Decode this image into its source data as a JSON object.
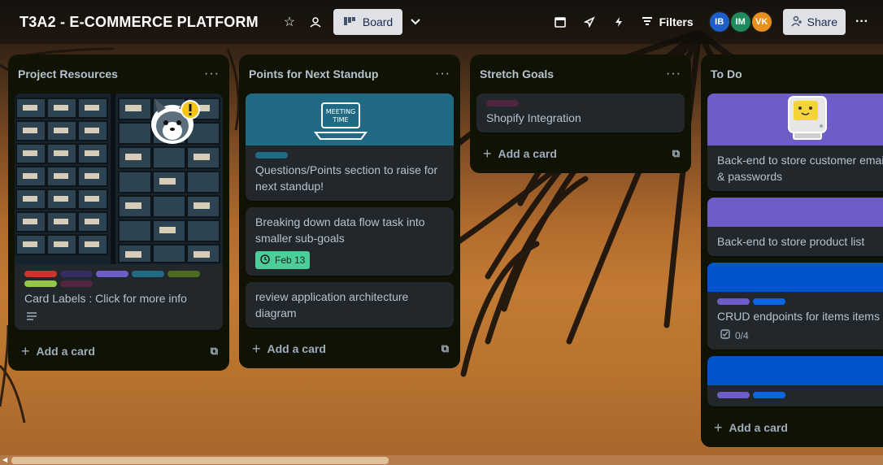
{
  "board": {
    "title": "T3A2 - E-COMMERCE PLATFORM",
    "view_label": "Board",
    "filters_label": "Filters",
    "share_label": "Share",
    "members": [
      {
        "initials": "IB",
        "color": "#1d5ec9"
      },
      {
        "initials": "IM",
        "color": "#1f8a5b"
      },
      {
        "initials": "VK",
        "color": "#e8901e"
      }
    ]
  },
  "lists": [
    {
      "title": "Project Resources",
      "add_card": "Add a card",
      "cards": [
        {
          "title": "Card Labels : Click for more info",
          "labels": [
            "#c9372c",
            "#352c63",
            "#6e5dc6",
            "#206a83",
            "#4c6b1f",
            "#94c748",
            "#50253f"
          ],
          "cover": "photo",
          "icons": [
            "description-icon"
          ]
        }
      ]
    },
    {
      "title": "Points for Next Standup",
      "add_card": "Add a card",
      "cards": [
        {
          "title": "Questions/Points section to raise for next standup!",
          "labels": [
            "#206a83"
          ],
          "cover": "#206a83",
          "sticker": "Meeting Time"
        },
        {
          "title": "Breaking down data flow task into smaller sub-goals",
          "due": "Feb 13"
        },
        {
          "title": "review application architecture diagram"
        }
      ]
    },
    {
      "title": "Stretch Goals",
      "add_card": "Add a card",
      "cards": [
        {
          "title": "Shopify Integration",
          "labels": [
            "#50253f"
          ]
        }
      ]
    },
    {
      "title": "To Do",
      "add_card": "Add a card",
      "cards": [
        {
          "title": "Back-end to store customer emails & passwords",
          "cover": "#6e5dc6"
        },
        {
          "title": "Back-end to store product list",
          "cover": "#6e5dc6"
        },
        {
          "title": "CRUD endpoints for items items",
          "cover": "#0055cc",
          "labels": [
            "#6e5dc6",
            "#0c66e4"
          ],
          "checklist": "0/4"
        },
        {
          "title": "",
          "cover": "#0055cc",
          "labels": [
            "#6e5dc6",
            "#0c66e4"
          ]
        }
      ]
    }
  ],
  "colors": {
    "list_bg": "#101204",
    "card_bg": "#22272b",
    "text": "#b6c2cf",
    "due_green": "#4bce97"
  }
}
